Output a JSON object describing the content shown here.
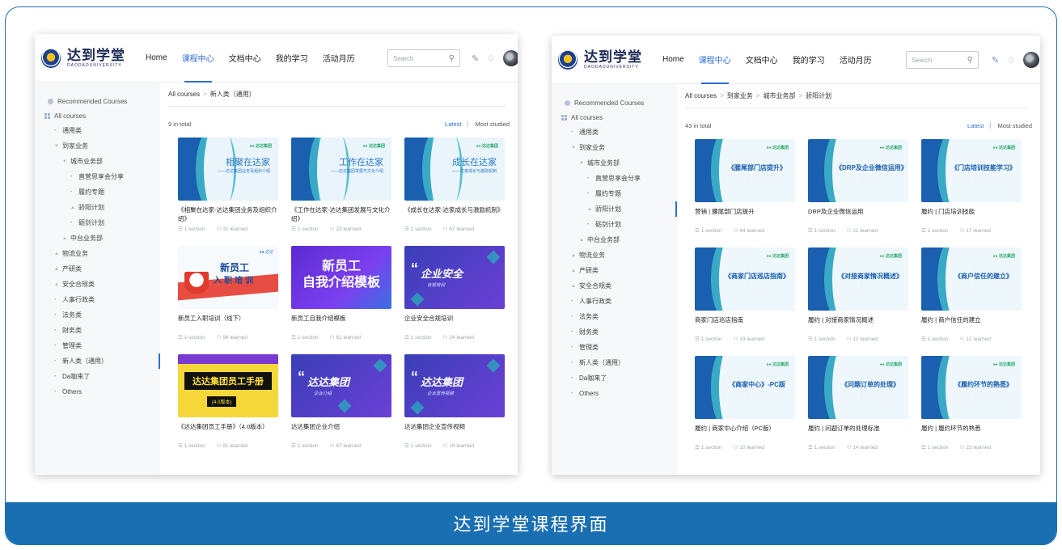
{
  "caption": "达到学堂课程界面",
  "colors": {
    "frame": "#1a6fb3",
    "accent": "#2b6fd6"
  },
  "app": {
    "logo_title": "达到学堂",
    "logo_sub": "DAODAOUNIVERSITY",
    "nav": [
      "Home",
      "课程中心",
      "文档中心",
      "我的学习",
      "活动月历"
    ],
    "active_nav": "课程中心",
    "search_placeholder": "Search",
    "icons": [
      "search-icon",
      "edit-icon",
      "bell-icon",
      "avatar"
    ]
  },
  "left": {
    "sidebar": {
      "recommended": "Recommended Courses",
      "all": "All courses",
      "items": [
        "通用类",
        "到家业务",
        "城市业务部",
        "直营思享会分享",
        "履约专题",
        "骄阳计划",
        "砺剑计划",
        "中台业务部",
        "物流业务",
        "产研类",
        "安全合规类",
        "人事行政类",
        "法务类",
        "财务类",
        "管理类",
        "新人类（通用）",
        "Da咖来了",
        "Others"
      ],
      "active": "新人类（通用）"
    },
    "breadcrumb": [
      "All courses",
      "新人类（通用）"
    ],
    "total": "9 in total",
    "sort": [
      "Latest",
      "Most studied"
    ],
    "courses": [
      {
        "title": "《相聚在达家-达达集团业务及组织介绍》",
        "sections": "1 section",
        "learned": "31 learned",
        "thumb_text": "相聚在达家",
        "thumb_sub": "——达达集团业务及组织介绍"
      },
      {
        "title": "《工作在达家-达达集团发展与文化介绍》",
        "sections": "1 section",
        "learned": "23 learned",
        "thumb_text": "工作在达家",
        "thumb_sub": "——达达集团发展与文化介绍"
      },
      {
        "title": "《成长在达家-达家成长与激励机制》",
        "sections": "1 section",
        "learned": "67 learned",
        "thumb_text": "成长在达家",
        "thumb_sub": "——达家成长与激励机制"
      },
      {
        "title": "新员工入职培训（线下）",
        "sections": "1 section",
        "learned": "96 learned",
        "thumb_text": "新员工",
        "thumb_sub": "入职培训"
      },
      {
        "title": "新员工自我介绍模板",
        "sections": "1 section",
        "learned": "61 learned",
        "thumb_text": "新员工",
        "thumb_sub": "自我介绍模板"
      },
      {
        "title": "企业安全合规培训",
        "sections": "1 section",
        "learned": "24 learned",
        "thumb_text": "企业安全",
        "thumb_sub": "合规培训"
      },
      {
        "title": "《达达集团员工手册》（4.0版本）",
        "sections": "1 section",
        "learned": "91 learned",
        "thumb_text": "达达集团员工手册",
        "thumb_sub": "(4.0版本)"
      },
      {
        "title": "达达集团企业介绍",
        "sections": "1 section",
        "learned": "67 learned",
        "thumb_text": "达达集团",
        "thumb_sub": "企业介绍"
      },
      {
        "title": "达达集团企业宣传视频",
        "sections": "1 section",
        "learned": "19 learned",
        "thumb_text": "达达集团",
        "thumb_sub": "企业宣传视频"
      }
    ]
  },
  "right": {
    "breadcrumb": [
      "All courses",
      "到家业务",
      "城市业务部",
      "骄阳计划"
    ],
    "total": "43 in total",
    "sidebar_active": "骄阳计划",
    "courses": [
      {
        "title": "营销 | 腰尾部门店提升",
        "sections": "1 section",
        "learned": "44 learned",
        "thumb_text": "《腰尾部门店提升》"
      },
      {
        "title": "DRP及企业微信运用",
        "sections": "1 section",
        "learned": "21 learned",
        "thumb_text": "《DRP及企业微信运用》"
      },
      {
        "title": "履约 | 门店培训技能",
        "sections": "1 section",
        "learned": "17 learned",
        "thumb_text": "《门店培训技能学习》"
      },
      {
        "title": "商家门店巡店指南",
        "sections": "1 section",
        "learned": "13 learned",
        "thumb_text": "《商家门店巡店指南》"
      },
      {
        "title": "履约 | 对接商家情况概述",
        "sections": "1 section",
        "learned": "12 learned",
        "thumb_text": "《对接商家情况概述》"
      },
      {
        "title": "履约 | 商户信任的建立",
        "sections": "1 section",
        "learned": "12 learned",
        "thumb_text": "《商户信任的建立》"
      },
      {
        "title": "履约 | 商家中心介绍（PC版）",
        "sections": "1 section",
        "learned": "10 learned",
        "thumb_text": "《商家中心》-PC版"
      },
      {
        "title": "履约 | 问题订单的处理标准",
        "sections": "1 section",
        "learned": "14 learned",
        "thumb_text": "《问题订单的处理》"
      },
      {
        "title": "履约 | 履约环节的熟悉",
        "sections": "1 section",
        "learned": "23 learned",
        "thumb_text": "《履约环节的熟悉》"
      }
    ]
  }
}
